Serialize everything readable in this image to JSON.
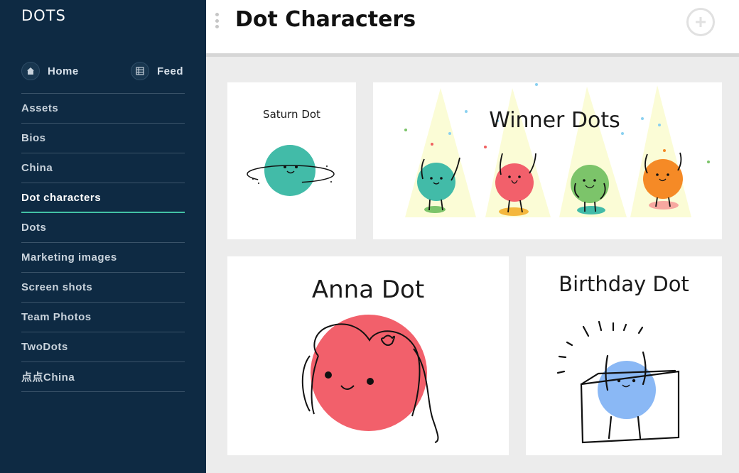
{
  "app": {
    "brand": "DOTS"
  },
  "quicknav": {
    "home_label": "Home",
    "feed_label": "Feed"
  },
  "sidebar": {
    "items": [
      {
        "label": "Assets"
      },
      {
        "label": "Bios"
      },
      {
        "label": "China"
      },
      {
        "label": "Dot characters",
        "active": true
      },
      {
        "label": "Dots"
      },
      {
        "label": "Marketing images"
      },
      {
        "label": "Screen shots"
      },
      {
        "label": "Team Photos"
      },
      {
        "label": "TwoDots"
      },
      {
        "label": "点点China"
      }
    ]
  },
  "header": {
    "title": "Dot Characters"
  },
  "cards": {
    "saturn": {
      "title": "Saturn Dot"
    },
    "winner": {
      "title": "Winner Dots"
    },
    "anna": {
      "title": "Anna Dot"
    },
    "birthday": {
      "title": "Birthday Dot"
    }
  },
  "colors": {
    "sidebar_bg": "#0e2a43",
    "accent": "#43c2a5",
    "teal_dot": "#42bba8",
    "red_dot": "#f2606b",
    "green_dot": "#7cc46a",
    "orange_dot": "#f58a26",
    "blue_dot": "#8ab8f5"
  }
}
